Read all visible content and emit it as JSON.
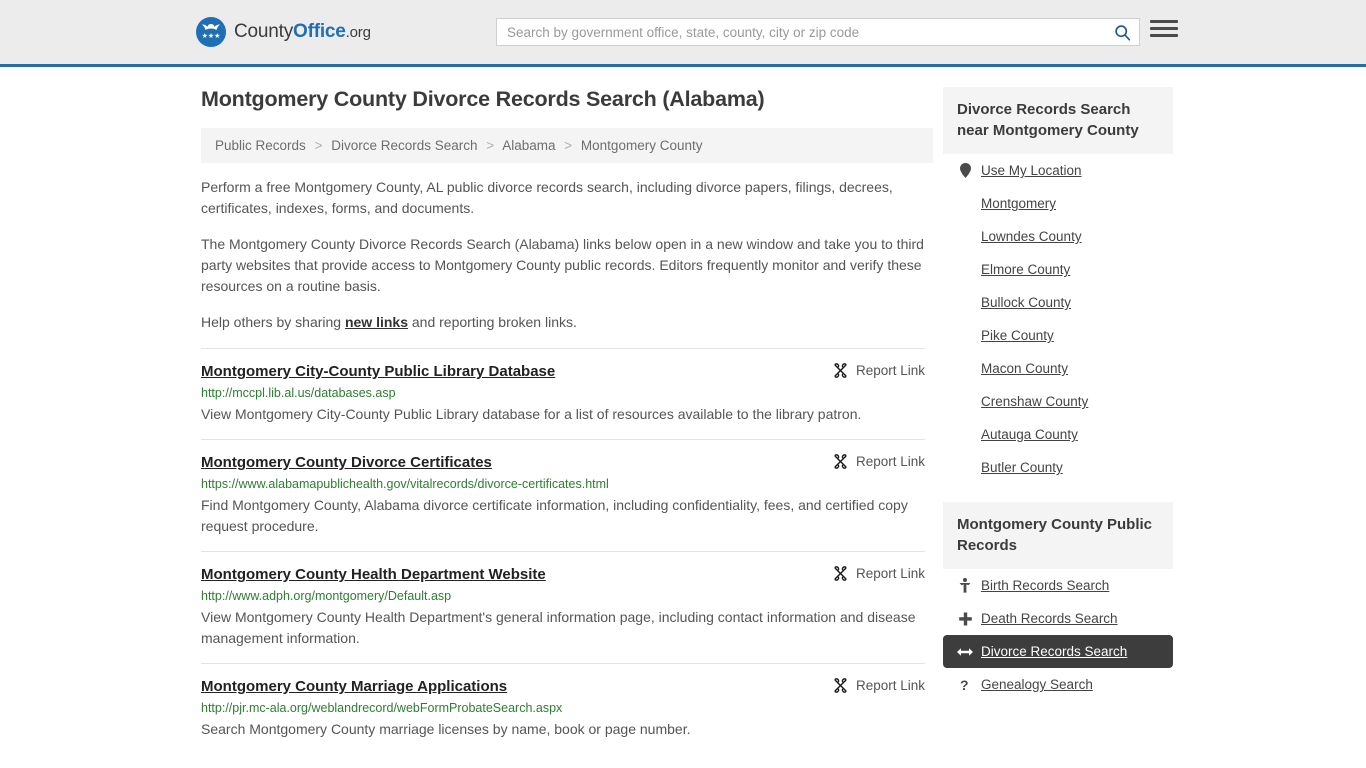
{
  "header": {
    "brand": {
      "part1": "County",
      "part2": "Office",
      "part3": ".org",
      "logo_icon": "eagle-shield-logo",
      "stars": "★★★"
    },
    "search": {
      "placeholder": "Search by government office, state, county, city or zip code",
      "value": "",
      "search_icon": "search-icon"
    },
    "menu_icon": "hamburger-menu-icon"
  },
  "page": {
    "title": "Montgomery County Divorce Records Search (Alabama)"
  },
  "breadcrumb": {
    "items": [
      "Public Records",
      "Divorce Records Search",
      "Alabama",
      "Montgomery County"
    ],
    "separator": ">"
  },
  "intro": {
    "p1": "Perform a free Montgomery County, AL public divorce records search, including divorce papers, filings, decrees, certificates, indexes, forms, and documents.",
    "p2": "The Montgomery County Divorce Records Search (Alabama) links below open in a new window and take you to third party websites that provide access to Montgomery County public records. Editors frequently monitor and verify these resources on a routine basis.",
    "p3_before": "Help others by sharing ",
    "p3_link": "new links",
    "p3_after": " and reporting broken links."
  },
  "results": {
    "report_label": "Report Link",
    "report_icon": "broken-link-icon",
    "items": [
      {
        "title": "Montgomery City-County Public Library Database",
        "url": "http://mccpl.lib.al.us/databases.asp",
        "desc": "View Montgomery City-County Public Library database for a list of resources available to the library patron."
      },
      {
        "title": "Montgomery County Divorce Certificates",
        "url": "https://www.alabamapublichealth.gov/vitalrecords/divorce-certificates.html",
        "desc": "Find Montgomery County, Alabama divorce certificate information, including confidentiality, fees, and certified copy request procedure."
      },
      {
        "title": "Montgomery County Health Department Website",
        "url": "http://www.adph.org/montgomery/Default.asp",
        "desc": "View Montgomery County Health Department's general information page, including contact information and disease management information."
      },
      {
        "title": "Montgomery County Marriage Applications",
        "url": "http://pjr.mc-ala.org/weblandrecord/webFormProbateSearch.aspx",
        "desc": "Search Montgomery County marriage licenses by name, book or page number."
      }
    ]
  },
  "sidebar": {
    "nearby": {
      "heading": "Divorce Records Search near Montgomery County",
      "items": [
        {
          "label": "Use My Location",
          "icon": "map-pin-icon"
        },
        {
          "label": "Montgomery",
          "icon": ""
        },
        {
          "label": "Lowndes County",
          "icon": ""
        },
        {
          "label": "Elmore County",
          "icon": ""
        },
        {
          "label": "Bullock County",
          "icon": ""
        },
        {
          "label": "Pike County",
          "icon": ""
        },
        {
          "label": "Macon County",
          "icon": ""
        },
        {
          "label": "Crenshaw County",
          "icon": ""
        },
        {
          "label": "Autauga County",
          "icon": ""
        },
        {
          "label": "Butler County",
          "icon": ""
        }
      ]
    },
    "public_records": {
      "heading": "Montgomery County Public Records",
      "items": [
        {
          "label": "Birth Records Search",
          "icon": "baby-icon",
          "active": false
        },
        {
          "label": "Death Records Search",
          "icon": "cross-icon",
          "active": false
        },
        {
          "label": "Divorce Records Search",
          "icon": "left-right-arrow-icon",
          "active": true
        },
        {
          "label": "Genealogy Search",
          "icon": "question-mark-icon",
          "active": false
        }
      ]
    }
  },
  "colors": {
    "brand_blue": "#1f6fb5",
    "header_bg": "#ececec",
    "header_border": "#2b6ca3",
    "url_green": "#2e7d32",
    "active_bg": "#3d3d3d"
  }
}
